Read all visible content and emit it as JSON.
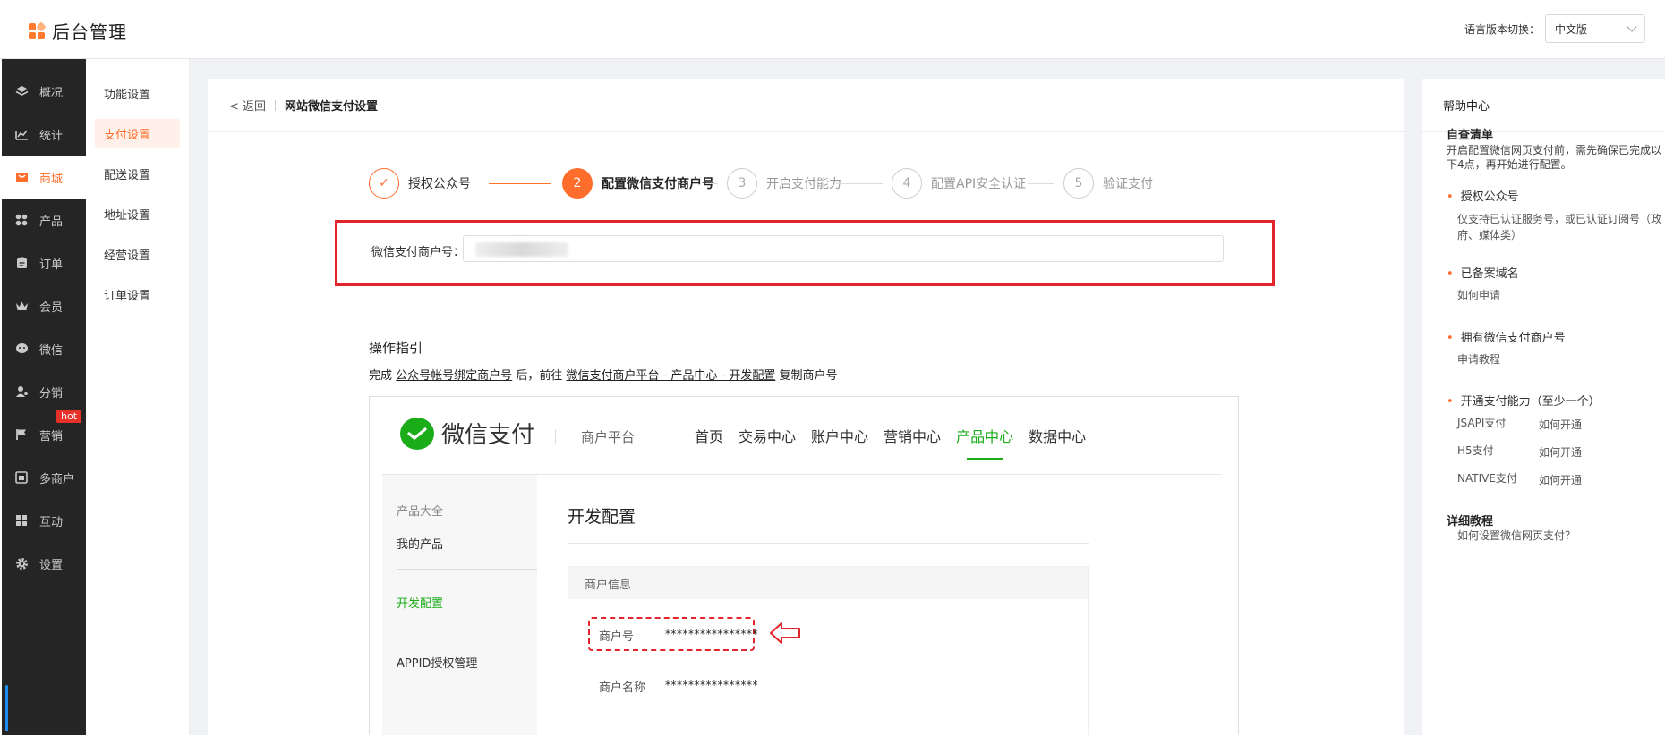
{
  "header": {
    "app_title": "后台管理",
    "lang_label": "语言版本切换：",
    "lang_value": "中文版"
  },
  "sidebar": {
    "items": [
      {
        "label": "概况",
        "icon": "layers-icon"
      },
      {
        "label": "统计",
        "icon": "chart-icon"
      },
      {
        "label": "商城",
        "icon": "store-icon"
      },
      {
        "label": "产品",
        "icon": "grid-icon"
      },
      {
        "label": "订单",
        "icon": "clipboard-icon"
      },
      {
        "label": "会员",
        "icon": "crown-icon"
      },
      {
        "label": "微信",
        "icon": "wechat-icon"
      },
      {
        "label": "分销",
        "icon": "users-icon"
      },
      {
        "label": "营销",
        "icon": "flag-icon"
      },
      {
        "label": "多商户",
        "icon": "shop-icon"
      },
      {
        "label": "互动",
        "icon": "interact-icon"
      },
      {
        "label": "设置",
        "icon": "gear-icon"
      }
    ],
    "hot_badge": "hot",
    "active_index": 2
  },
  "subnav": {
    "items": [
      "功能设置",
      "支付设置",
      "配送设置",
      "地址设置",
      "经营设置",
      "订单设置"
    ],
    "active_index": 1
  },
  "breadcrumb": {
    "back": "< 返回",
    "title": "网站微信支付设置"
  },
  "steps": [
    {
      "num": "✓",
      "label": "授权公众号"
    },
    {
      "num": "2",
      "label": "配置微信支付商户号"
    },
    {
      "num": "3",
      "label": "开启支付能力"
    },
    {
      "num": "4",
      "label": "配置API安全认证"
    },
    {
      "num": "5",
      "label": "验证支付"
    }
  ],
  "form": {
    "merchant_label": "微信支付商户号："
  },
  "guide": {
    "title": "操作指引",
    "text_prefix": "完成",
    "link1": "公众号帐号绑定商户号",
    "text_mid": "后，前往",
    "link2": "微信支付商户平台 - 产品中心 - 开发配置",
    "text_suffix": "复制商户号"
  },
  "wechat_screenshot": {
    "logo_text": "微信支付",
    "platform": "商户平台",
    "nav": [
      "首页",
      "交易中心",
      "账户中心",
      "营销中心",
      "产品中心",
      "数据中心"
    ],
    "nav_active": 4,
    "left": {
      "all_products": "产品大全",
      "my_products": "我的产品",
      "dev_config": "开发配置",
      "appid_mgmt": "APPID授权管理"
    },
    "heading": "开发配置",
    "box_title": "商户信息",
    "merchant_no_label": "商户号",
    "merchant_no_value": "****************",
    "merchant_name_label": "商户名称",
    "merchant_name_value": "****************",
    "brand_color": "#1aad19"
  },
  "help": {
    "title": "帮助中心",
    "checklist_title": "自查清单",
    "checklist_text": "开启配置微信网页支付前，需先确保已完成以下4点，再开始进行配置。",
    "items": [
      {
        "title": "授权公众号",
        "desc": "仅支持已认证服务号，或已认证订阅号（政府、媒体类）"
      },
      {
        "title": "已备案域名",
        "desc": "如何申请"
      },
      {
        "title": "拥有微信支付商户号",
        "desc": "申请教程"
      },
      {
        "title": "开通支付能力（至少一个）",
        "rows": [
          {
            "name": "JSAPI支付",
            "link": "如何开通"
          },
          {
            "name": "H5支付",
            "link": "如何开通"
          },
          {
            "name": "NATIVE支付",
            "link": "如何开通"
          }
        ]
      }
    ],
    "tutorial_title": "详细教程",
    "tutorial_link": "如何设置微信网页支付？"
  },
  "accent_color": "#ff6d2d",
  "alert_color": "#e4242c"
}
